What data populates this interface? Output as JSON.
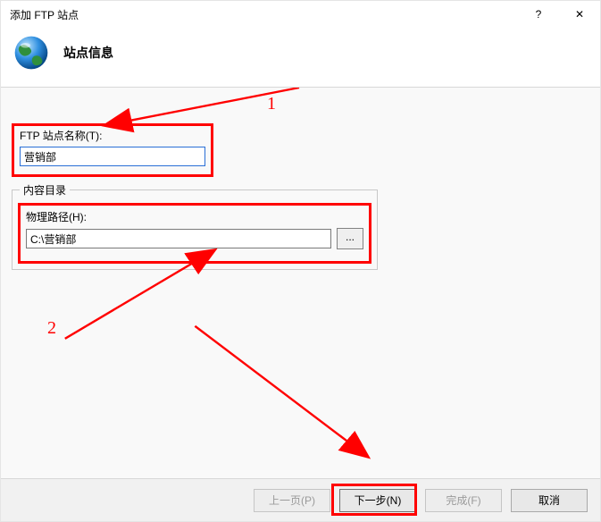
{
  "titlebar": {
    "title": "添加 FTP 站点",
    "help": "?",
    "close": "✕"
  },
  "header": {
    "title": "站点信息"
  },
  "site_name": {
    "label": "FTP 站点名称(T):",
    "value": "营销部"
  },
  "content_dir": {
    "legend": "内容目录",
    "path_label": "物理路径(H):",
    "path_value": "C:\\营销部",
    "browse": "..."
  },
  "annotations": {
    "one": "1",
    "two": "2"
  },
  "footer": {
    "prev": "上一页(P)",
    "next": "下一步(N)",
    "finish": "完成(F)",
    "cancel": "取消"
  }
}
